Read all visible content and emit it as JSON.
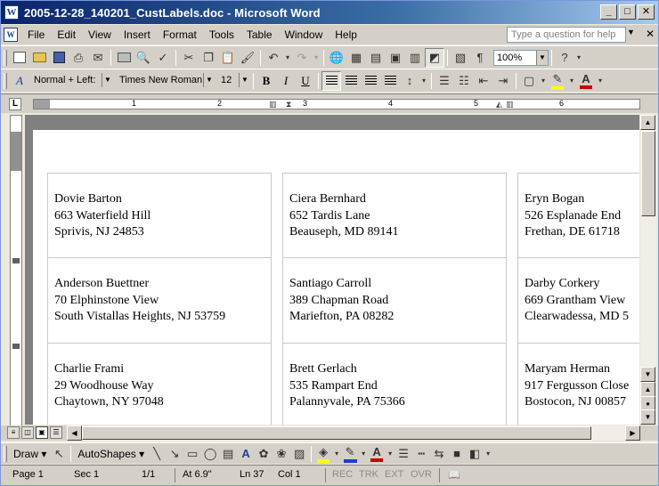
{
  "window": {
    "title": "2005-12-28_140201_CustLabels.doc - Microsoft Word",
    "minimize": "_",
    "maximize": "□",
    "close": "✕"
  },
  "menu": {
    "items": [
      "File",
      "Edit",
      "View",
      "Insert",
      "Format",
      "Tools",
      "Table",
      "Window",
      "Help"
    ],
    "help_placeholder": "Type a question for help",
    "doc_close": "✕"
  },
  "toolbar_standard": {
    "zoom": "100%"
  },
  "toolbar_format": {
    "style": "Normal + Left:",
    "font": "Times New Roman",
    "size": "12",
    "bold": "B",
    "italic": "I",
    "underline": "U"
  },
  "ruler": {
    "numbers": [
      "1",
      "2",
      "3",
      "4",
      "5",
      "6"
    ]
  },
  "labels": [
    [
      {
        "name": "Dovie Barton",
        "street": "663 Waterfield Hill",
        "city": "Sprivis, NJ 24853"
      },
      {
        "name": "Ciera Bernhard",
        "street": "652 Tardis Lane",
        "city": "Beauseph, MD 89141"
      },
      {
        "name": "Eryn Bogan",
        "street": "526 Esplanade End",
        "city": "Frethan, DE 61718"
      }
    ],
    [
      {
        "name": "Anderson Buettner",
        "street": "70 Elphinstone View",
        "city": "South Vistallas Heights, NJ 53759"
      },
      {
        "name": "Santiago Carroll",
        "street": "389 Chapman Road",
        "city": "Mariefton, PA 08282"
      },
      {
        "name": "Darby Corkery",
        "street": "669 Grantham View",
        "city": "Clearwadessa, MD 5"
      }
    ],
    [
      {
        "name": "Charlie Frami",
        "street": "29 Woodhouse Way",
        "city": "Chaytown, NY 97048"
      },
      {
        "name": "Brett Gerlach",
        "street": "535 Rampart End",
        "city": "Palannyvale, PA 75366"
      },
      {
        "name": "Maryam Herman",
        "street": "917 Fergusson Close",
        "city": "Bostocon, NJ 00857"
      }
    ]
  ],
  "drawbar": {
    "draw": "Draw ▾",
    "autoshapes": "AutoShapes ▾"
  },
  "status": {
    "page": "Page 1",
    "sec": "Sec 1",
    "pages": "1/1",
    "at": "At 6.9\"",
    "ln": "Ln 37",
    "col": "Col 1",
    "rec": "REC",
    "trk": "TRK",
    "ext": "EXT",
    "ovr": "OVR"
  }
}
